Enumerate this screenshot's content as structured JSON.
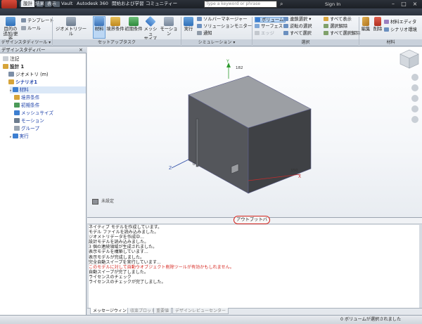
{
  "titlebar": {
    "search_placeholder": "Type a keyword or phrase",
    "sign_in": "Sign In"
  },
  "tabs": [
    {
      "label": "設計",
      "active": true
    },
    {
      "label": "結果",
      "active": false
    },
    {
      "label": "表示",
      "active": false
    },
    {
      "label": "Vault",
      "active": false
    },
    {
      "label": "Autodesk 360",
      "active": false
    },
    {
      "label": "開始および学習",
      "active": false
    },
    {
      "label": "コミュニティー",
      "active": false
    }
  ],
  "ribbon": {
    "panels": [
      {
        "title": "デザインスタディツール ▾"
      },
      {
        "title": "セットアップタスク"
      },
      {
        "title": "シミュレーション ▾"
      },
      {
        "title": "選択"
      },
      {
        "title": "材料"
      }
    ],
    "design_study": {
      "goal_label": "目的の",
      "goal_label2": "追加/更新",
      "template": "テンプレート",
      "rule": "ルール"
    },
    "setup": {
      "geometry_tool": "ジオメトリツール",
      "material": "材料",
      "boundary": "境界条件",
      "initial": "初期条件",
      "mesh": "メッシュ",
      "mesh2": "サイズ",
      "motion": "モーション"
    },
    "simulation": {
      "run": "実行",
      "solver_manager": "ソルバーマネージャー",
      "solution_monitor": "ソリューションモニター",
      "notify": "通知"
    },
    "selection": {
      "volume": "ボリューム",
      "surface": "サーフェス",
      "edge": "エッジ",
      "chain_select": "連鎖選択",
      "chain_select_dd": "▾",
      "reverse_select": "逆転の選択",
      "select_all": "すべて選択",
      "show_all": "すべて表示",
      "deselect": "選択解除",
      "deselect_all": "すべて選択解除"
    },
    "material": {
      "edit": "編集",
      "delete": "削除",
      "material_editor": "材料エディタ",
      "scenario_env": "シナリオ環境"
    }
  },
  "left_panel": {
    "header": "デザインスタディバー",
    "close_label": "×",
    "items": [
      {
        "label": "注記",
        "indent": 0,
        "icon": "note-icon"
      },
      {
        "label": "設計 1",
        "indent": 0,
        "icon": "design-icon",
        "bold": true
      },
      {
        "label": "ジオメトリ (m)",
        "indent": 1,
        "icon": "geometry-icon"
      },
      {
        "label": "シナリオ1",
        "indent": 1,
        "icon": "scenario-icon",
        "bold": true
      },
      {
        "label": "材料",
        "indent": 2,
        "icon": "material-icon",
        "selected": true
      },
      {
        "label": "境界条件",
        "indent": 2,
        "icon": "boundary-icon"
      },
      {
        "label": "初期条件",
        "indent": 2,
        "icon": "initial-icon"
      },
      {
        "label": "メッシュサイズ",
        "indent": 2,
        "icon": "mesh-icon"
      },
      {
        "label": "モーション",
        "indent": 2,
        "icon": "motion-icon"
      },
      {
        "label": "グループ",
        "indent": 2,
        "icon": "group-icon"
      },
      {
        "label": "実行",
        "indent": 2,
        "icon": "run-icon"
      }
    ]
  },
  "viewport": {
    "axis_y_value": "182",
    "axis_x_value": "350",
    "axis_x_label": "X",
    "axis_y_label": "Y",
    "axis_z_label": "Z",
    "origin_label": "0",
    "legend_label": "未設定"
  },
  "output": {
    "title": "アウトプットバー",
    "lines": [
      {
        "text": "ネイティブ モデルを作成しています。",
        "red": false
      },
      {
        "text": "モデル ファイルを読み込みました。",
        "red": false
      },
      {
        "text": "ジオメトリデータを作成中...",
        "red": false
      },
      {
        "text": "設計モデルを読み込みました。",
        "red": false
      },
      {
        "text": "3 個の連続領域が生成されました。",
        "red": false
      },
      {
        "text": "表示モデルを構築しています...",
        "red": false
      },
      {
        "text": "表示モデルが完成しました。",
        "red": false
      },
      {
        "text": "完全自動スイープを実行しています...",
        "red": false
      },
      {
        "text": "このモデルに対して自動ウオブジェクト削除ツールが有効かもしれません。",
        "red": true
      },
      {
        "text": "自動スイープが完了しました。",
        "red": false
      },
      {
        "text": "ライセンスのチェック",
        "red": false
      },
      {
        "text": "ライセンスのチェックが完了しました。",
        "red": false
      }
    ]
  },
  "bottom_tabs": [
    {
      "label": "メッセージウィンドウ",
      "active": true
    },
    {
      "label": "収束プロット",
      "active": false
    },
    {
      "label": "重要値",
      "active": false
    },
    {
      "label": "デザインレビューセンター",
      "active": false
    }
  ],
  "status": {
    "text": "0 ボリュームが選択されました"
  },
  "colors": {
    "accent": "#3d7fd1",
    "highlight_red": "#d0201a",
    "box_top": "#9c9fa4",
    "box_front": "#4a4c50"
  }
}
